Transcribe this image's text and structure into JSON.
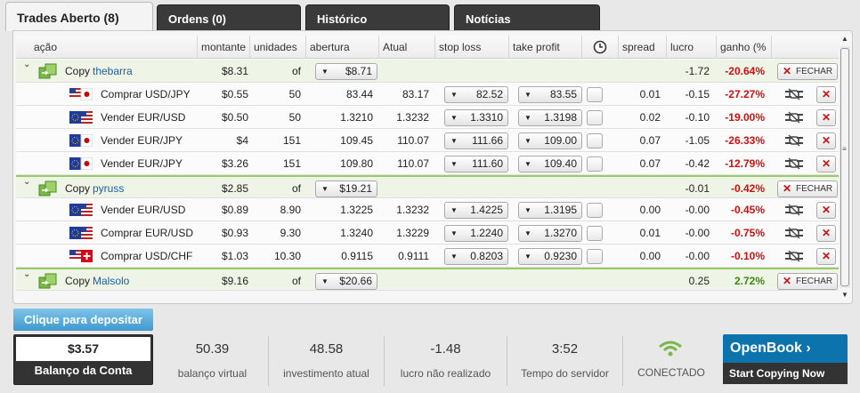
{
  "tabs": [
    {
      "label": "Trades Aberto",
      "count": "(8)"
    },
    {
      "label": "Ordens (0)"
    },
    {
      "label": "Histórico"
    },
    {
      "label": "Notícias"
    }
  ],
  "columns": [
    "ação",
    "montante",
    "unidades",
    "abertura",
    "Atual",
    "stop loss",
    "take profit",
    "",
    "spread",
    "lucro",
    "ganho (%"
  ],
  "groups": [
    {
      "copy_label": "Copy",
      "trader": "thebarra",
      "montante": "$8.31",
      "unidades": "of",
      "abertura": "$8.71",
      "lucro": "-1.72",
      "ganho": "-20.64%",
      "close_label": "FECHAR",
      "trades": [
        {
          "acao": "Comprar USD/JPY",
          "flag": "us-jp",
          "montante": "$0.55",
          "unidades": "50",
          "abertura": "83.44",
          "atual": "83.17",
          "stop": "82.52",
          "take": "83.55",
          "spread": "0.01",
          "lucro": "-0.15",
          "ganho": "-27.27%"
        },
        {
          "acao": "Vender EUR/USD",
          "flag": "eu-us",
          "montante": "$0.50",
          "unidades": "50",
          "abertura": "1.3210",
          "atual": "1.3232",
          "stop": "1.3310",
          "take": "1.3198",
          "spread": "0.02",
          "lucro": "-0.10",
          "ganho": "-19.00%"
        },
        {
          "acao": "Vender EUR/JPY",
          "flag": "eu-jp",
          "montante": "$4",
          "unidades": "151",
          "abertura": "109.45",
          "atual": "110.07",
          "stop": "111.66",
          "take": "109.00",
          "spread": "0.07",
          "lucro": "-1.05",
          "ganho": "-26.33%"
        },
        {
          "acao": "Vender EUR/JPY",
          "flag": "eu-jp",
          "montante": "$3.26",
          "unidades": "151",
          "abertura": "109.80",
          "atual": "110.07",
          "stop": "111.60",
          "take": "109.40",
          "spread": "0.07",
          "lucro": "-0.42",
          "ganho": "-12.79%"
        }
      ]
    },
    {
      "copy_label": "Copy",
      "trader": "pyruss",
      "montante": "$2.85",
      "unidades": "of",
      "abertura": "$19.21",
      "lucro": "-0.01",
      "ganho": "-0.42%",
      "close_label": "FECHAR",
      "trades": [
        {
          "acao": "Vender EUR/USD",
          "flag": "eu-us",
          "montante": "$0.89",
          "unidades": "8.90",
          "abertura": "1.3225",
          "atual": "1.3232",
          "stop": "1.4225",
          "take": "1.3195",
          "spread": "0.00",
          "lucro": "-0.00",
          "ganho": "-0.45%"
        },
        {
          "acao": "Comprar EUR/USD",
          "flag": "eu-us",
          "montante": "$0.93",
          "unidades": "9.30",
          "abertura": "1.3240",
          "atual": "1.3229",
          "stop": "1.2240",
          "take": "1.3270",
          "spread": "0.01",
          "lucro": "-0.00",
          "ganho": "-0.75%"
        },
        {
          "acao": "Comprar USD/CHF",
          "flag": "us-ch",
          "montante": "$1.03",
          "unidades": "10.30",
          "abertura": "0.9115",
          "atual": "0.9111",
          "stop": "0.8203",
          "take": "0.9230",
          "spread": "0.00",
          "lucro": "-0.00",
          "ganho": "-0.10%"
        }
      ]
    },
    {
      "copy_label": "Copy",
      "trader": "Malsolo",
      "montante": "$9.16",
      "unidades": "of",
      "abertura": "$20.66",
      "lucro": "0.25",
      "ganho": "2.72%",
      "close_label": "FECHAR",
      "trades": []
    }
  ],
  "deposit_label": "Clique para depositar",
  "balance": {
    "value": "$3.57",
    "label": "Balanço da Conta"
  },
  "stats": [
    {
      "value": "50.39",
      "label": "balanço virtual"
    },
    {
      "value": "48.58",
      "label": "investimento atual"
    },
    {
      "value": "-1.48",
      "label": "lucro não realizado"
    },
    {
      "value": "3:52",
      "label": "Tempo do servidor"
    }
  ],
  "connection": {
    "label": "CONECTADO",
    "icon": "wifi-icon",
    "color": "#7ab648"
  },
  "openbook": {
    "title": "OpenBook",
    "subtitle": "Start Copying Now"
  },
  "colors": {
    "negative": "#cc1111",
    "positive": "#3c8a12",
    "accent": "#0c73ad",
    "trader_link": "#1a5fa8"
  }
}
